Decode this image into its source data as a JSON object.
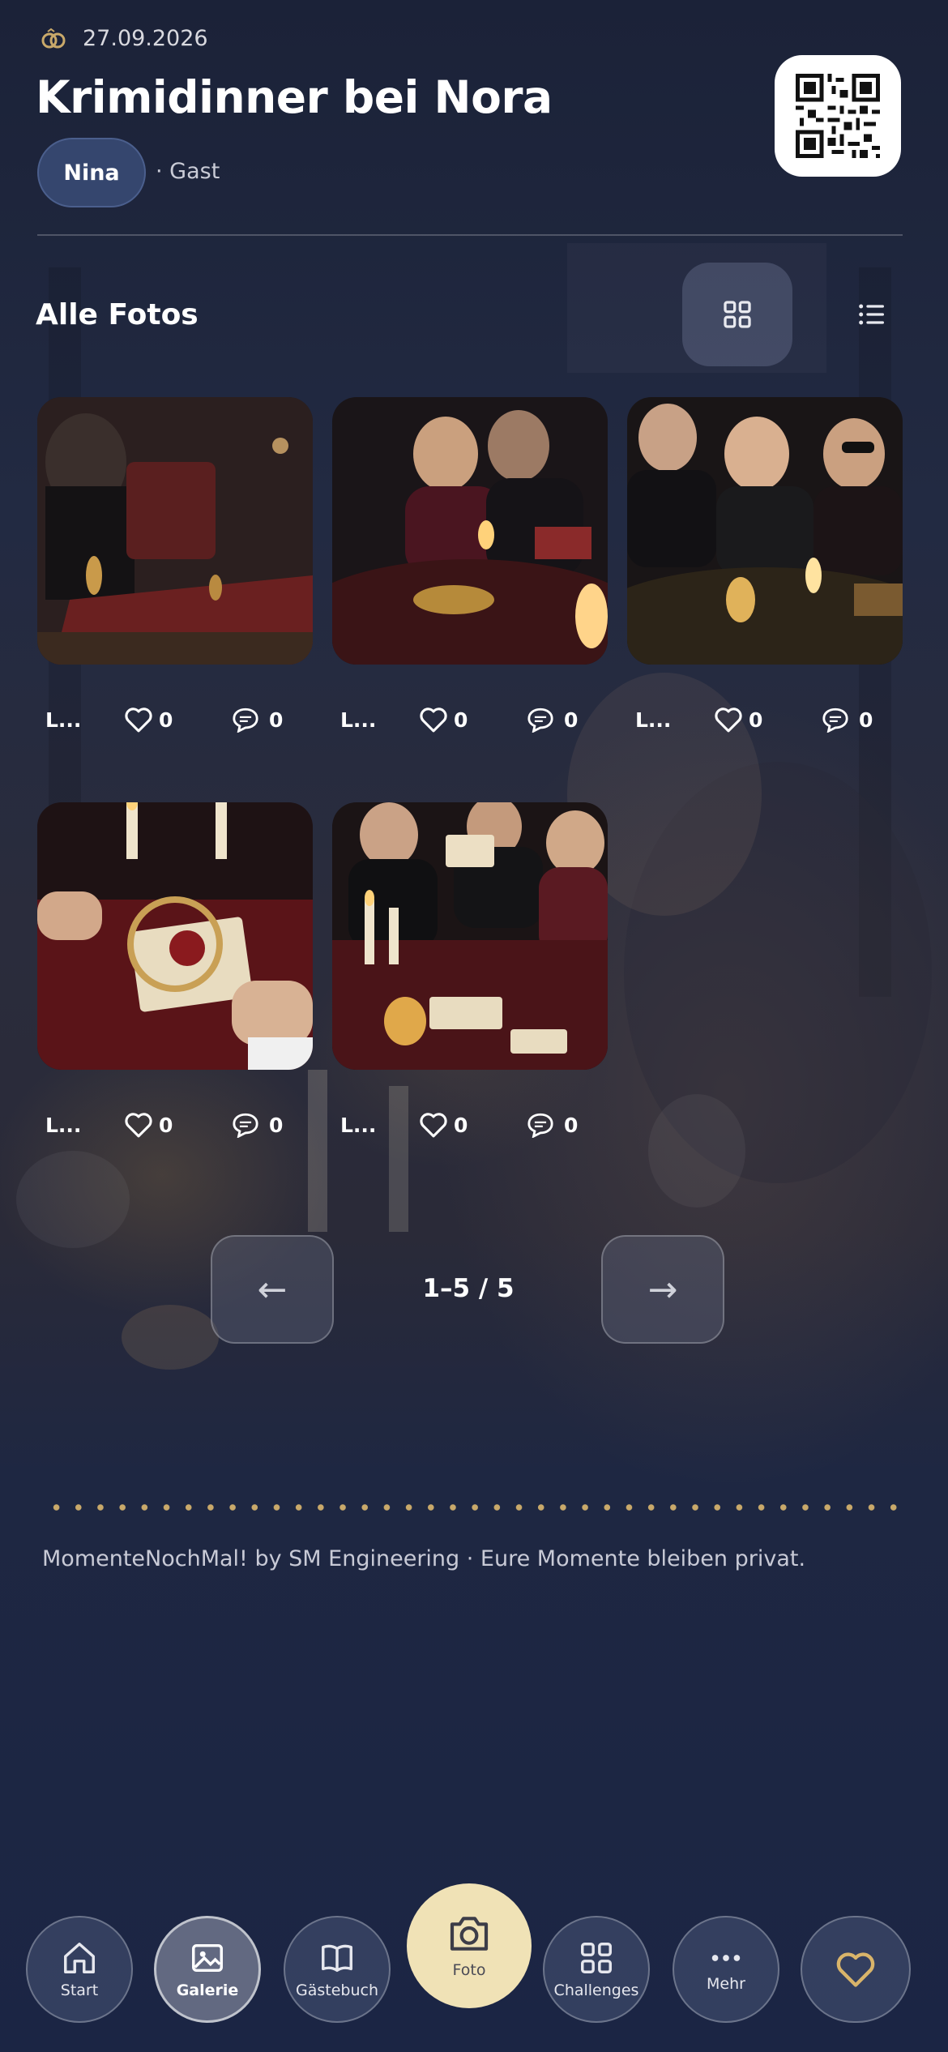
{
  "header": {
    "date": "27.09.2026",
    "title": "Krimidinner bei Nora",
    "user_name": "Nina",
    "role": "· Gast"
  },
  "gallery": {
    "section_title": "Alle Fotos",
    "view_modes": [
      "grid-icon",
      "list-icon"
    ],
    "photos": [
      {
        "owner": "L...",
        "likes": "0",
        "comments": "0",
        "scene": "man in tuxedo at candlelit dinner table"
      },
      {
        "owner": "L...",
        "likes": "0",
        "comments": "0",
        "scene": "guests talking at candlelit table"
      },
      {
        "owner": "L...",
        "likes": "0",
        "comments": "0",
        "scene": "laughing guests with masquerade mask"
      },
      {
        "owner": "L...",
        "likes": "0",
        "comments": "0",
        "scene": "magnifying glass over sealed letter"
      },
      {
        "owner": "L...",
        "likes": "0",
        "comments": "0",
        "scene": "guests reading envelopes by candlelight"
      }
    ]
  },
  "pagination": {
    "prev": "←",
    "label": "1–5 / 5",
    "next": "→"
  },
  "footer": {
    "text": "MomenteNochMal! by SM Engineering · Eure Momente bleiben privat."
  },
  "nav": {
    "start": "Start",
    "galerie": "Galerie",
    "gaestebuch": "Gästebuch",
    "foto": "Foto",
    "challenges": "Challenges",
    "mehr": "Mehr"
  },
  "colors": {
    "background": "#1c2440",
    "accent_gold": "#c9a96a",
    "camera_button": "#f0e2b6",
    "chip": "#35466e"
  }
}
